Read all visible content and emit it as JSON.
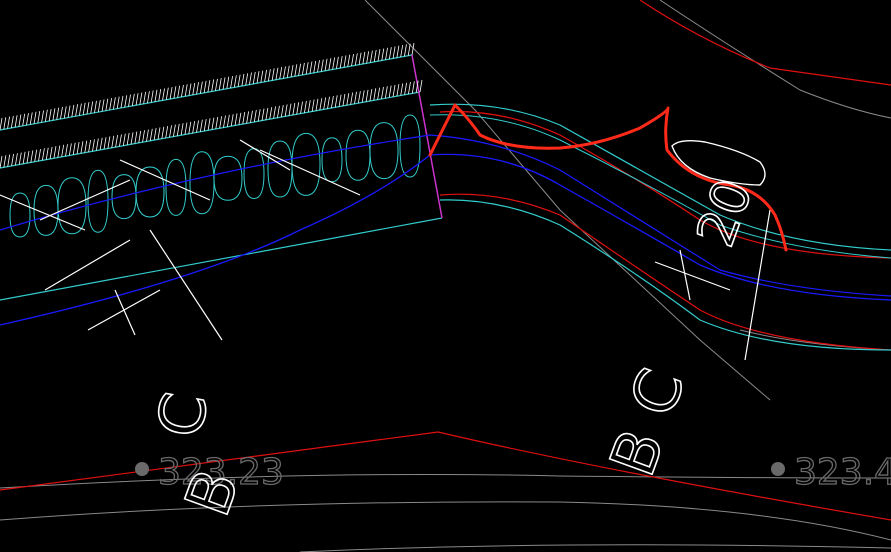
{
  "colors": {
    "background": "#000000",
    "cyan": "#33cccc",
    "blue": "#1a1aff",
    "red": "#e01010",
    "white": "#ffffff",
    "gray": "#8a8a8a",
    "magenta": "#cc33cc",
    "markup_red": "#ff2a1a"
  },
  "annotations": {
    "left_label_top": "C",
    "left_label_bottom": "B",
    "right_label_top": "C",
    "right_label_bottom": "B",
    "right_label_small": "20",
    "elev_left": "323.23",
    "elev_right": "323.4"
  }
}
